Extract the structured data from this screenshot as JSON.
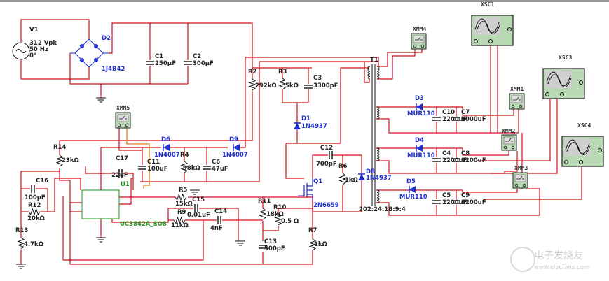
{
  "colors": {
    "wire": "#d0101c",
    "component": "#111111",
    "diode": "#2030d0",
    "ic": "#1a9a1a",
    "instrument_fill": "#b9d8b4",
    "probe_wire": "#e07a10"
  },
  "source": {
    "ref": "V1",
    "amplitude": "312 Vpk",
    "frequency": "50 Hz",
    "phase": "0°"
  },
  "bridge": {
    "ref": "D2",
    "part": "1J4B42"
  },
  "capacitors": {
    "C1": {
      "ref": "C1",
      "value": "250µF"
    },
    "C2": {
      "ref": "C2",
      "value": "300µF"
    },
    "C3": {
      "ref": "C3",
      "value": "3300pF"
    },
    "C4": {
      "ref": "C4",
      "value": "2200uF"
    },
    "C5": {
      "ref": "C5",
      "value": "2200uF"
    },
    "C6": {
      "ref": "C6",
      "value": "47uF"
    },
    "C7": {
      "ref": "C7",
      "value": "1000uF"
    },
    "C8": {
      "ref": "C8",
      "value": "2200uF"
    },
    "C9": {
      "ref": "C9",
      "value": "2200uF"
    },
    "C10": {
      "ref": "C10",
      "value": "2200uF"
    },
    "C11": {
      "ref": "C11",
      "value": "100uF"
    },
    "C12": {
      "ref": "C12",
      "value": "700pF"
    },
    "C13": {
      "ref": "C13",
      "value": "500pF"
    },
    "C14": {
      "ref": "C14",
      "value": "4nF"
    },
    "C15": {
      "ref": "C15",
      "value": "0.01uF"
    },
    "C16": {
      "ref": "C16",
      "value": "100pF"
    },
    "C17": {
      "ref": "C17",
      "value": "22uF"
    }
  },
  "resistors": {
    "R2": {
      "ref": "R2",
      "value": "292kΩ"
    },
    "R3": {
      "ref": "R3",
      "value": "5kΩ"
    },
    "R4": {
      "ref": "R4",
      "value": "98kΩ"
    },
    "R5": {
      "ref": "R5",
      "value": "15kΩ"
    },
    "R6": {
      "ref": "R6",
      "value": "1kΩ"
    },
    "R7": {
      "ref": "R7",
      "value": "1kΩ"
    },
    "R9": {
      "ref": "R9",
      "value": "11kΩ"
    },
    "R10": {
      "ref": "R10",
      "value": "0.5 Ω"
    },
    "R11": {
      "ref": "R11",
      "value": "18kΩ"
    },
    "R12": {
      "ref": "R12",
      "value": "20kΩ"
    },
    "R13": {
      "ref": "R13",
      "value": "4.7kΩ"
    },
    "R14": {
      "ref": "R14",
      "value": "23kΩ"
    }
  },
  "diodes": {
    "D1": {
      "ref": "D1",
      "part": "1N4937"
    },
    "D3": {
      "ref": "D3",
      "part": "MUR110"
    },
    "D4": {
      "ref": "D4",
      "part": "MUR110"
    },
    "D5": {
      "ref": "D5",
      "part": "MUR110"
    },
    "D6": {
      "ref": "D6",
      "part": "1N4007"
    },
    "D8": {
      "ref": "D8",
      "part": "1N4937"
    },
    "D9": {
      "ref": "D9",
      "part": "1N4007"
    }
  },
  "mosfet": {
    "ref": "Q1",
    "part": "2N6659"
  },
  "ic": {
    "ref": "U1",
    "part": "UC3842A_SO8"
  },
  "transformer": {
    "ref": "T1",
    "ratio": "202:24:18:9:4"
  },
  "instruments": {
    "XMM1": "XMM1",
    "XMM2": "XMM2",
    "XMM3": "XMM3",
    "XMM4": "XMM4",
    "XMM5": "XMM5",
    "XSC1": "XSC1",
    "XSC3": "XSC3",
    "XSC4": "XSC4"
  },
  "watermark": {
    "name": "电子发烧友",
    "url": "www.elecfans.com"
  }
}
